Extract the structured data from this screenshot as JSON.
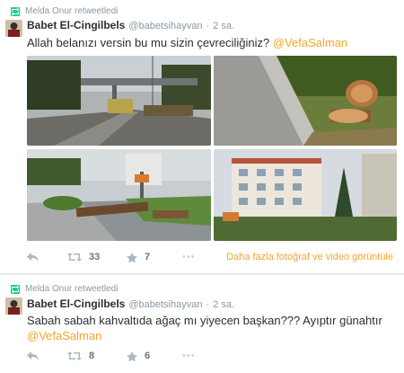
{
  "tweets": [
    {
      "retweeted_by": "Melda Onur retweetledi",
      "fullname": "Babet El-Cingilbels",
      "username": "@babetsihayvan",
      "separator": "·",
      "time": "2 sa.",
      "text": "Allah belanızı versin bu mu sizin çevreciliğiniz? ",
      "mention": "@VefaSalman",
      "retweet_count": "33",
      "favorite_count": "7",
      "more": "•••",
      "view_more": "Daha fazla fotoğraf ve video görüntüle"
    },
    {
      "retweeted_by": "Melda Onur retweetledi",
      "fullname": "Babet El-Cingilbels",
      "username": "@babetsihayvan",
      "separator": "·",
      "time": "2 sa.",
      "text": "Sabah sabah kahvaltıda ağaç mı yiyecen başkan??? Ayıptır günahtır",
      "mention": "@VefaSalman",
      "retweet_count": "8",
      "favorite_count": "6",
      "more": "•••"
    }
  ],
  "colors": {
    "link": "#f4a52c",
    "muted": "#8899a6",
    "retweet_green": "#19cf86",
    "text": "#292f33"
  },
  "icons": [
    "retweet-icon",
    "reply-icon",
    "star-icon",
    "more-icon"
  ]
}
